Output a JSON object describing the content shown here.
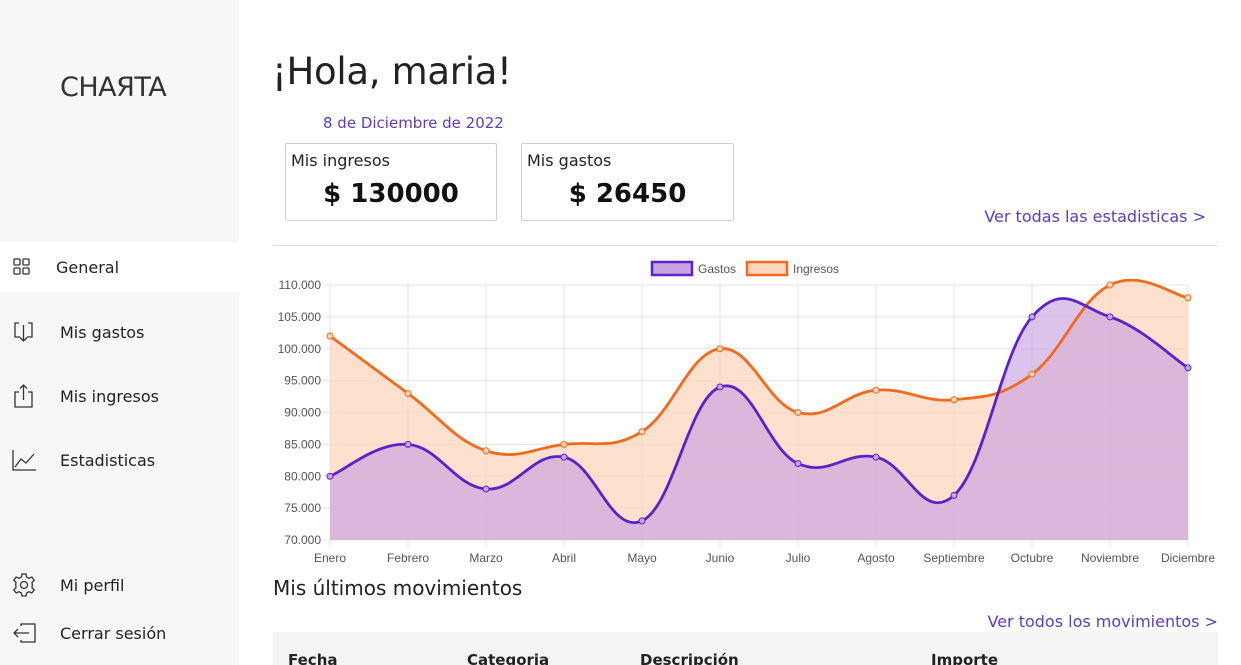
{
  "sidebar": {
    "logo": "CHAЯTA",
    "items": [
      {
        "label": "General",
        "icon": "grid-icon"
      },
      {
        "label": "Mis gastos",
        "icon": "download-icon"
      },
      {
        "label": "Mis ingresos",
        "icon": "upload-icon"
      },
      {
        "label": "Estadisticas",
        "icon": "line-chart-icon"
      }
    ],
    "bottom_items": [
      {
        "label": "Mi perfil",
        "icon": "gear-icon"
      },
      {
        "label": "Cerrar sesión",
        "icon": "logout-icon"
      }
    ]
  },
  "main": {
    "greeting": "¡Hola, maria!",
    "date": "8 de Diciembre de 2022",
    "cards": [
      {
        "label": "Mis ingresos",
        "value": "$ 130000"
      },
      {
        "label": "Mis gastos",
        "value": "$ 26450"
      }
    ],
    "stats_link": "Ver todas las estadisticas >",
    "movements_title": "Mis últimos movimientos",
    "movements_link": "Ver todos los movimientos >",
    "table_headers": [
      "Fecha",
      "Categoria",
      "Descripción",
      "Importe"
    ]
  },
  "colors": {
    "accent": "#5b3cc4",
    "gastos_line": "#5b22c9",
    "gastos_fill": "#c9a3e2",
    "ingresos_line": "#f26a1b",
    "ingresos_fill": "#fcd5bd"
  },
  "chart_data": {
    "type": "area",
    "categories": [
      "Enero",
      "Febrero",
      "Marzo",
      "Abril",
      "Mayo",
      "Junio",
      "Julio",
      "Agosto",
      "Septiembre",
      "Octubre",
      "Noviembre",
      "Diciembre"
    ],
    "series": [
      {
        "name": "Gastos",
        "values": [
          80000,
          85000,
          78000,
          83000,
          73000,
          94000,
          82000,
          83000,
          77000,
          105000,
          105000,
          97000
        ]
      },
      {
        "name": "Ingresos",
        "values": [
          102000,
          93000,
          84000,
          85000,
          87000,
          100000,
          90000,
          93500,
          92000,
          96000,
          110000,
          108000
        ]
      }
    ],
    "ylim": [
      70000,
      110000
    ],
    "yticks": [
      "70.000",
      "75.000",
      "80.000",
      "85.000",
      "90.000",
      "95.000",
      "100.000",
      "105.000",
      "110.000"
    ],
    "grid": true,
    "legend": "top"
  }
}
